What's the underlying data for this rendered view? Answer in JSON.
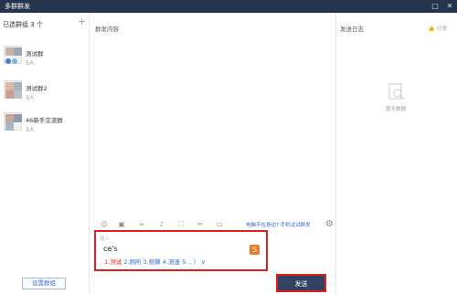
{
  "window": {
    "title": "多群群发",
    "controls": [
      "□",
      "✕"
    ]
  },
  "left_panel": {
    "header": "已选群组   3 个",
    "add_symbol": "+",
    "groups": [
      {
        "name": "测试群",
        "count": "5人"
      },
      {
        "name": "测试群2",
        "count": "3人"
      },
      {
        "name": "46新手交流群",
        "count": "3人"
      }
    ],
    "setting_button": "设置群组"
  },
  "center_panel": {
    "heading": "群发内容",
    "toolbar_icons": [
      "smile-icon",
      "image-icon",
      "link-icon",
      "mic-icon",
      "screenshot-icon",
      "scissors-icon",
      "folder-icon"
    ],
    "hint_link": "电脑不在身边? 手机试试群发",
    "input_placeholder": "输入",
    "ime": {
      "typed": "ce's",
      "first_candidate": "1.测试",
      "candidates": " 2.厕所  3.侧算  4.测速  5.  ,  〉  ∨",
      "logo": "S"
    },
    "send_button": "发送"
  },
  "right_panel": {
    "heading": "发送日志",
    "share_label": "分享",
    "empty_text": "暂无数据"
  },
  "colors": {
    "titlebar": "#24344c",
    "accent_blue": "#2f6ccf",
    "highlight_red": "#e02020",
    "send_button": "#2f4360"
  }
}
